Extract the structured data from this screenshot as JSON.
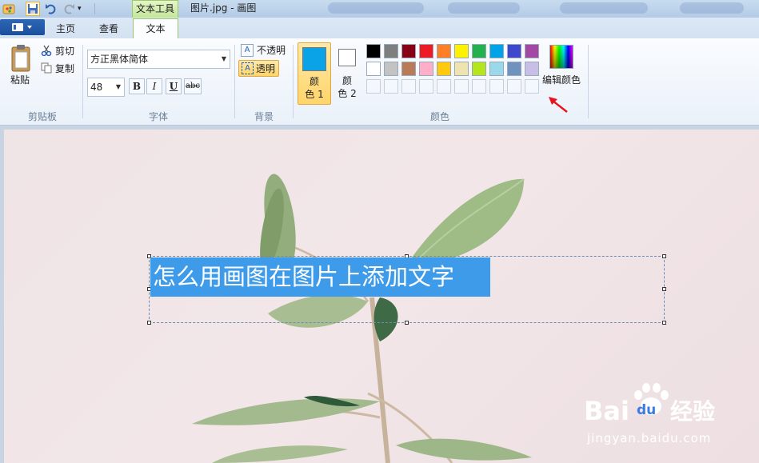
{
  "window": {
    "title": "图片.jpg - 画图",
    "context_tab": "文本工具"
  },
  "tabs": {
    "home": "主页",
    "view": "查看",
    "text": "文本"
  },
  "clipboard": {
    "paste": "粘贴",
    "cut": "剪切",
    "copy": "复制",
    "group": "剪贴板"
  },
  "font": {
    "family": "方正黑体简体",
    "size": "48",
    "bold": "B",
    "italic": "I",
    "underline": "U",
    "strike": "abc",
    "group": "字体"
  },
  "background": {
    "opaque": "不透明",
    "transparent": "透明",
    "group": "背景"
  },
  "colors": {
    "color1_a": "颜",
    "color1_b": "色 1",
    "color2_a": "颜",
    "color2_b": "色 2",
    "edit": "编辑颜色",
    "group": "颜色",
    "color1_value": "#0aa3e8",
    "color2_value": "#ffffff",
    "palette_row1": [
      "#000000",
      "#7f7f7f",
      "#880015",
      "#ed1c24",
      "#ff7f27",
      "#fff200",
      "#22b14c",
      "#00a2e8",
      "#3f48cc",
      "#a349a4"
    ],
    "palette_row2": [
      "#ffffff",
      "#c3c3c3",
      "#b97a57",
      "#ffaec9",
      "#ffc90e",
      "#efe4b0",
      "#b5e61d",
      "#99d9ea",
      "#7092be",
      "#c8bfe7"
    ]
  },
  "canvas": {
    "text": "怎么用画图在图片上添加文字"
  },
  "watermark": {
    "brand": "Bai",
    "brand2": "经验",
    "url": "jingyan.baidu.com"
  }
}
